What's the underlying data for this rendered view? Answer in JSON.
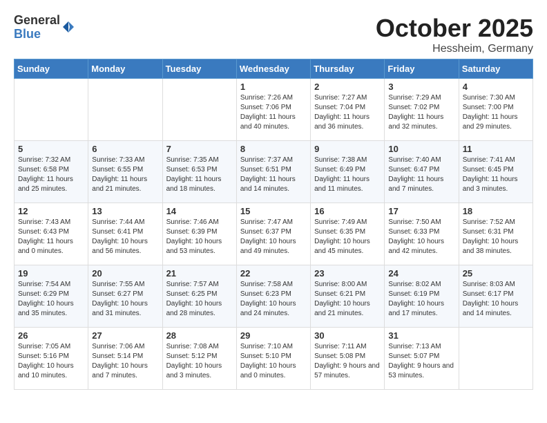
{
  "header": {
    "logo": {
      "general": "General",
      "blue": "Blue"
    },
    "month_title": "October 2025",
    "location": "Hessheim, Germany"
  },
  "calendar": {
    "days_of_week": [
      "Sunday",
      "Monday",
      "Tuesday",
      "Wednesday",
      "Thursday",
      "Friday",
      "Saturday"
    ],
    "weeks": [
      [
        {
          "day": "",
          "sunrise": "",
          "sunset": "",
          "daylight": ""
        },
        {
          "day": "",
          "sunrise": "",
          "sunset": "",
          "daylight": ""
        },
        {
          "day": "",
          "sunrise": "",
          "sunset": "",
          "daylight": ""
        },
        {
          "day": "1",
          "sunrise": "Sunrise: 7:26 AM",
          "sunset": "Sunset: 7:06 PM",
          "daylight": "Daylight: 11 hours and 40 minutes."
        },
        {
          "day": "2",
          "sunrise": "Sunrise: 7:27 AM",
          "sunset": "Sunset: 7:04 PM",
          "daylight": "Daylight: 11 hours and 36 minutes."
        },
        {
          "day": "3",
          "sunrise": "Sunrise: 7:29 AM",
          "sunset": "Sunset: 7:02 PM",
          "daylight": "Daylight: 11 hours and 32 minutes."
        },
        {
          "day": "4",
          "sunrise": "Sunrise: 7:30 AM",
          "sunset": "Sunset: 7:00 PM",
          "daylight": "Daylight: 11 hours and 29 minutes."
        }
      ],
      [
        {
          "day": "5",
          "sunrise": "Sunrise: 7:32 AM",
          "sunset": "Sunset: 6:58 PM",
          "daylight": "Daylight: 11 hours and 25 minutes."
        },
        {
          "day": "6",
          "sunrise": "Sunrise: 7:33 AM",
          "sunset": "Sunset: 6:55 PM",
          "daylight": "Daylight: 11 hours and 21 minutes."
        },
        {
          "day": "7",
          "sunrise": "Sunrise: 7:35 AM",
          "sunset": "Sunset: 6:53 PM",
          "daylight": "Daylight: 11 hours and 18 minutes."
        },
        {
          "day": "8",
          "sunrise": "Sunrise: 7:37 AM",
          "sunset": "Sunset: 6:51 PM",
          "daylight": "Daylight: 11 hours and 14 minutes."
        },
        {
          "day": "9",
          "sunrise": "Sunrise: 7:38 AM",
          "sunset": "Sunset: 6:49 PM",
          "daylight": "Daylight: 11 hours and 11 minutes."
        },
        {
          "day": "10",
          "sunrise": "Sunrise: 7:40 AM",
          "sunset": "Sunset: 6:47 PM",
          "daylight": "Daylight: 11 hours and 7 minutes."
        },
        {
          "day": "11",
          "sunrise": "Sunrise: 7:41 AM",
          "sunset": "Sunset: 6:45 PM",
          "daylight": "Daylight: 11 hours and 3 minutes."
        }
      ],
      [
        {
          "day": "12",
          "sunrise": "Sunrise: 7:43 AM",
          "sunset": "Sunset: 6:43 PM",
          "daylight": "Daylight: 11 hours and 0 minutes."
        },
        {
          "day": "13",
          "sunrise": "Sunrise: 7:44 AM",
          "sunset": "Sunset: 6:41 PM",
          "daylight": "Daylight: 10 hours and 56 minutes."
        },
        {
          "day": "14",
          "sunrise": "Sunrise: 7:46 AM",
          "sunset": "Sunset: 6:39 PM",
          "daylight": "Daylight: 10 hours and 53 minutes."
        },
        {
          "day": "15",
          "sunrise": "Sunrise: 7:47 AM",
          "sunset": "Sunset: 6:37 PM",
          "daylight": "Daylight: 10 hours and 49 minutes."
        },
        {
          "day": "16",
          "sunrise": "Sunrise: 7:49 AM",
          "sunset": "Sunset: 6:35 PM",
          "daylight": "Daylight: 10 hours and 45 minutes."
        },
        {
          "day": "17",
          "sunrise": "Sunrise: 7:50 AM",
          "sunset": "Sunset: 6:33 PM",
          "daylight": "Daylight: 10 hours and 42 minutes."
        },
        {
          "day": "18",
          "sunrise": "Sunrise: 7:52 AM",
          "sunset": "Sunset: 6:31 PM",
          "daylight": "Daylight: 10 hours and 38 minutes."
        }
      ],
      [
        {
          "day": "19",
          "sunrise": "Sunrise: 7:54 AM",
          "sunset": "Sunset: 6:29 PM",
          "daylight": "Daylight: 10 hours and 35 minutes."
        },
        {
          "day": "20",
          "sunrise": "Sunrise: 7:55 AM",
          "sunset": "Sunset: 6:27 PM",
          "daylight": "Daylight: 10 hours and 31 minutes."
        },
        {
          "day": "21",
          "sunrise": "Sunrise: 7:57 AM",
          "sunset": "Sunset: 6:25 PM",
          "daylight": "Daylight: 10 hours and 28 minutes."
        },
        {
          "day": "22",
          "sunrise": "Sunrise: 7:58 AM",
          "sunset": "Sunset: 6:23 PM",
          "daylight": "Daylight: 10 hours and 24 minutes."
        },
        {
          "day": "23",
          "sunrise": "Sunrise: 8:00 AM",
          "sunset": "Sunset: 6:21 PM",
          "daylight": "Daylight: 10 hours and 21 minutes."
        },
        {
          "day": "24",
          "sunrise": "Sunrise: 8:02 AM",
          "sunset": "Sunset: 6:19 PM",
          "daylight": "Daylight: 10 hours and 17 minutes."
        },
        {
          "day": "25",
          "sunrise": "Sunrise: 8:03 AM",
          "sunset": "Sunset: 6:17 PM",
          "daylight": "Daylight: 10 hours and 14 minutes."
        }
      ],
      [
        {
          "day": "26",
          "sunrise": "Sunrise: 7:05 AM",
          "sunset": "Sunset: 5:16 PM",
          "daylight": "Daylight: 10 hours and 10 minutes."
        },
        {
          "day": "27",
          "sunrise": "Sunrise: 7:06 AM",
          "sunset": "Sunset: 5:14 PM",
          "daylight": "Daylight: 10 hours and 7 minutes."
        },
        {
          "day": "28",
          "sunrise": "Sunrise: 7:08 AM",
          "sunset": "Sunset: 5:12 PM",
          "daylight": "Daylight: 10 hours and 3 minutes."
        },
        {
          "day": "29",
          "sunrise": "Sunrise: 7:10 AM",
          "sunset": "Sunset: 5:10 PM",
          "daylight": "Daylight: 10 hours and 0 minutes."
        },
        {
          "day": "30",
          "sunrise": "Sunrise: 7:11 AM",
          "sunset": "Sunset: 5:08 PM",
          "daylight": "Daylight: 9 hours and 57 minutes."
        },
        {
          "day": "31",
          "sunrise": "Sunrise: 7:13 AM",
          "sunset": "Sunset: 5:07 PM",
          "daylight": "Daylight: 9 hours and 53 minutes."
        },
        {
          "day": "",
          "sunrise": "",
          "sunset": "",
          "daylight": ""
        }
      ]
    ]
  }
}
